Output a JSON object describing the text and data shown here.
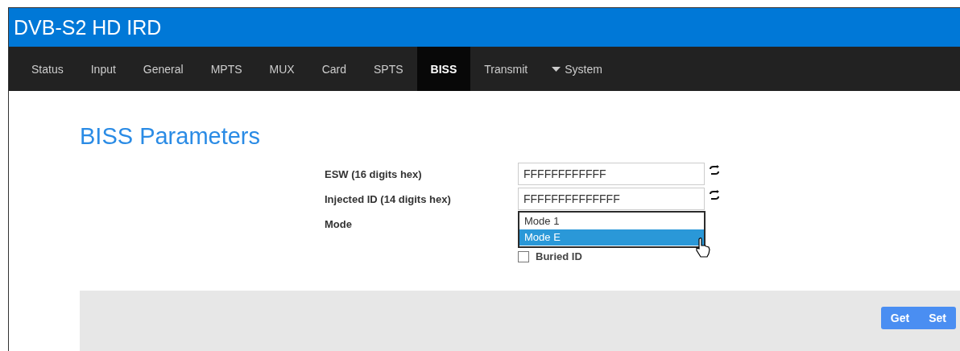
{
  "app_title": "DVB-S2 HD IRD",
  "nav": [
    {
      "label": "Status",
      "selected": false,
      "kind": "tab"
    },
    {
      "label": "Input",
      "selected": false,
      "kind": "tab"
    },
    {
      "label": "General",
      "selected": false,
      "kind": "tab"
    },
    {
      "label": "MPTS",
      "selected": false,
      "kind": "tab"
    },
    {
      "label": "MUX",
      "selected": false,
      "kind": "tab"
    },
    {
      "label": "Card",
      "selected": false,
      "kind": "tab"
    },
    {
      "label": "SPTS",
      "selected": false,
      "kind": "tab"
    },
    {
      "label": "BISS",
      "selected": true,
      "kind": "tab"
    },
    {
      "label": "Transmit",
      "selected": false,
      "kind": "tab"
    },
    {
      "label": "System",
      "selected": false,
      "kind": "menu"
    }
  ],
  "heading": "BISS Parameters",
  "esw": {
    "label": "ESW (16 digits hex)",
    "value": "FFFFFFFFFFFF"
  },
  "injected_id": {
    "label": "Injected ID (14 digits hex)",
    "value": "FFFFFFFFFFFFFF"
  },
  "mode": {
    "label": "Mode",
    "options": [
      {
        "label": "Mode 1",
        "selected": false
      },
      {
        "label": "Mode E",
        "selected": true
      }
    ]
  },
  "buried_id": {
    "label": "Buried ID",
    "checked": false
  },
  "buttons": [
    "Get",
    "Set"
  ]
}
